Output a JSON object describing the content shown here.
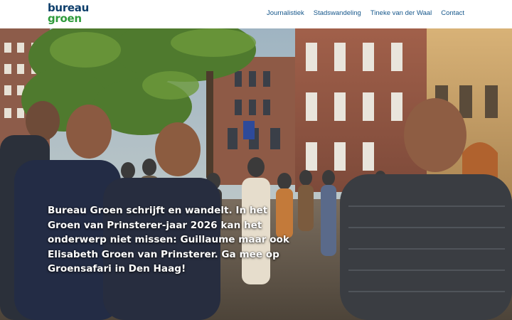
{
  "header": {
    "logo": {
      "line1": "bureau",
      "line2": "groen"
    },
    "nav": [
      {
        "label": "Journalistiek"
      },
      {
        "label": "Stadswandeling"
      },
      {
        "label": "Tineke van der Waal"
      },
      {
        "label": "Contact"
      }
    ]
  },
  "hero": {
    "caption": "Bureau Groen schrijft en wandelt. In het Groen van Prinsterer-jaar 2026 kan het onderwerp niet missen: Guillaume maar ook Elisabeth Groen van Prinsterer. Ga mee op Groensafari in Den Haag!"
  },
  "colors": {
    "logo_blue": "#0d3e6b",
    "logo_green": "#2e9b3b",
    "nav_link": "#16578b",
    "caption_text": "#ffffff"
  }
}
